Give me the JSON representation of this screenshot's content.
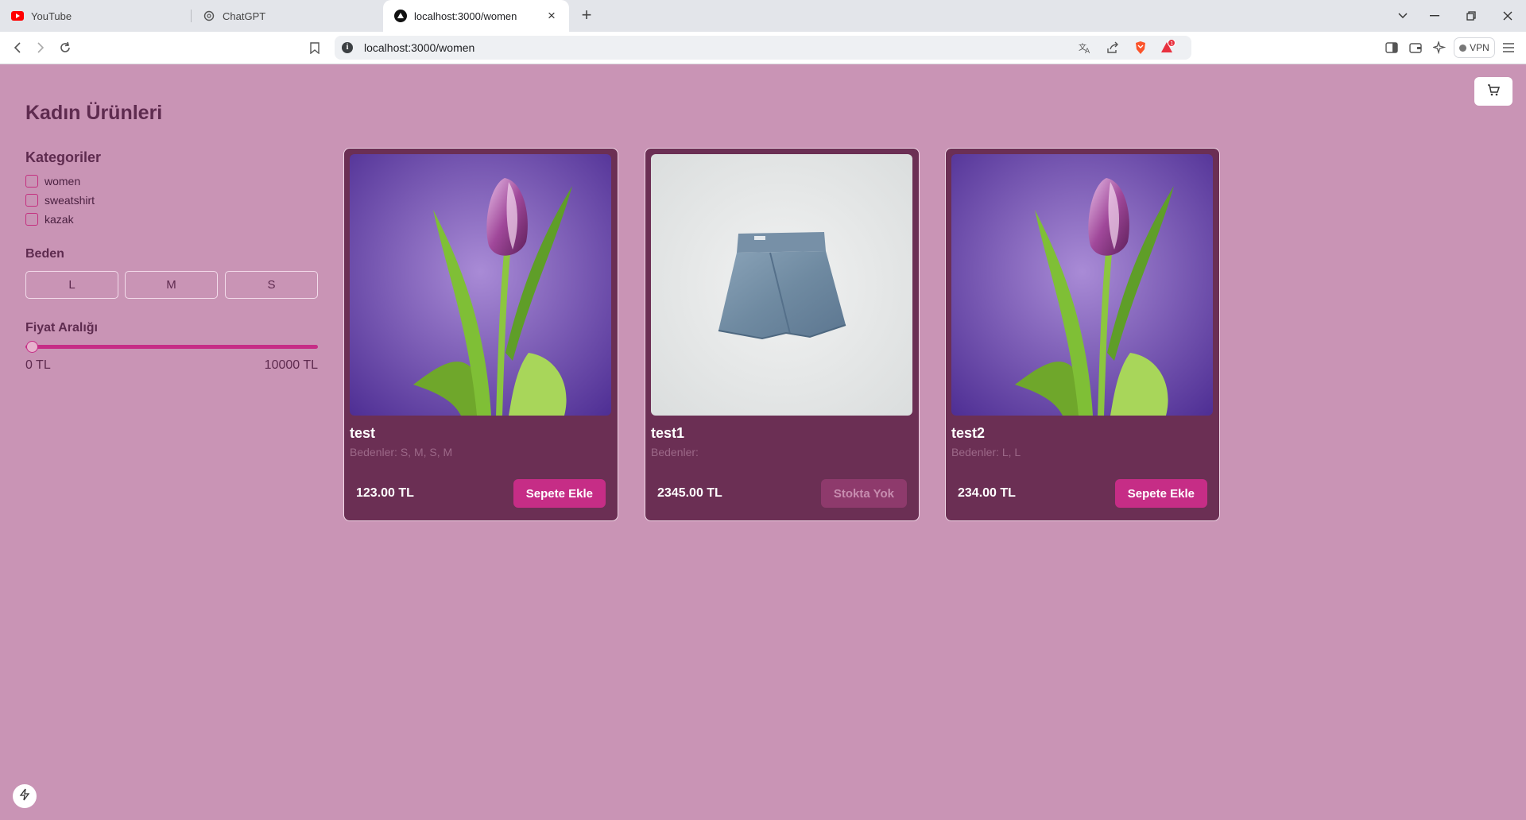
{
  "browser": {
    "tabs": [
      {
        "title": "YouTube",
        "icon": "youtube-icon"
      },
      {
        "title": "ChatGPT",
        "icon": "chatgpt-icon"
      },
      {
        "title": "localhost:3000/women",
        "icon": "app-triangle-icon",
        "active": true
      }
    ],
    "url": "localhost:3000/women",
    "vpn_label": "VPN",
    "notification_count": "1",
    "colors": {
      "brave": "#fb542b"
    }
  },
  "page": {
    "title": "Kadın Ürünleri",
    "categories_title": "Kategoriler",
    "categories": [
      {
        "label": "women",
        "checked": false
      },
      {
        "label": "sweatshirt",
        "checked": false
      },
      {
        "label": "kazak",
        "checked": false
      }
    ],
    "size_title": "Beden",
    "sizes": [
      "L",
      "M",
      "S"
    ],
    "price_title": "Fiyat Aralığı",
    "price_min": "0 TL",
    "price_max": "10000 TL",
    "slider_value_fraction": 0
  },
  "products": [
    {
      "name": "test",
      "sizes": "Bedenler: S, M, S, M",
      "price": "123.00 TL",
      "cta": "Sepete Ekle",
      "in_stock": true,
      "image": "tulip"
    },
    {
      "name": "test1",
      "sizes": "Bedenler:",
      "price": "2345.00 TL",
      "cta": "Stokta Yok",
      "in_stock": false,
      "image": "denim-skirt"
    },
    {
      "name": "test2",
      "sizes": "Bedenler: L, L",
      "price": "234.00 TL",
      "cta": "Sepete Ekle",
      "in_stock": true,
      "image": "tulip"
    }
  ],
  "colors": {
    "page_bg": "#c994b5",
    "card_bg": "#6b2f54",
    "accent": "#c62d86",
    "heading": "#5e2b4f"
  }
}
